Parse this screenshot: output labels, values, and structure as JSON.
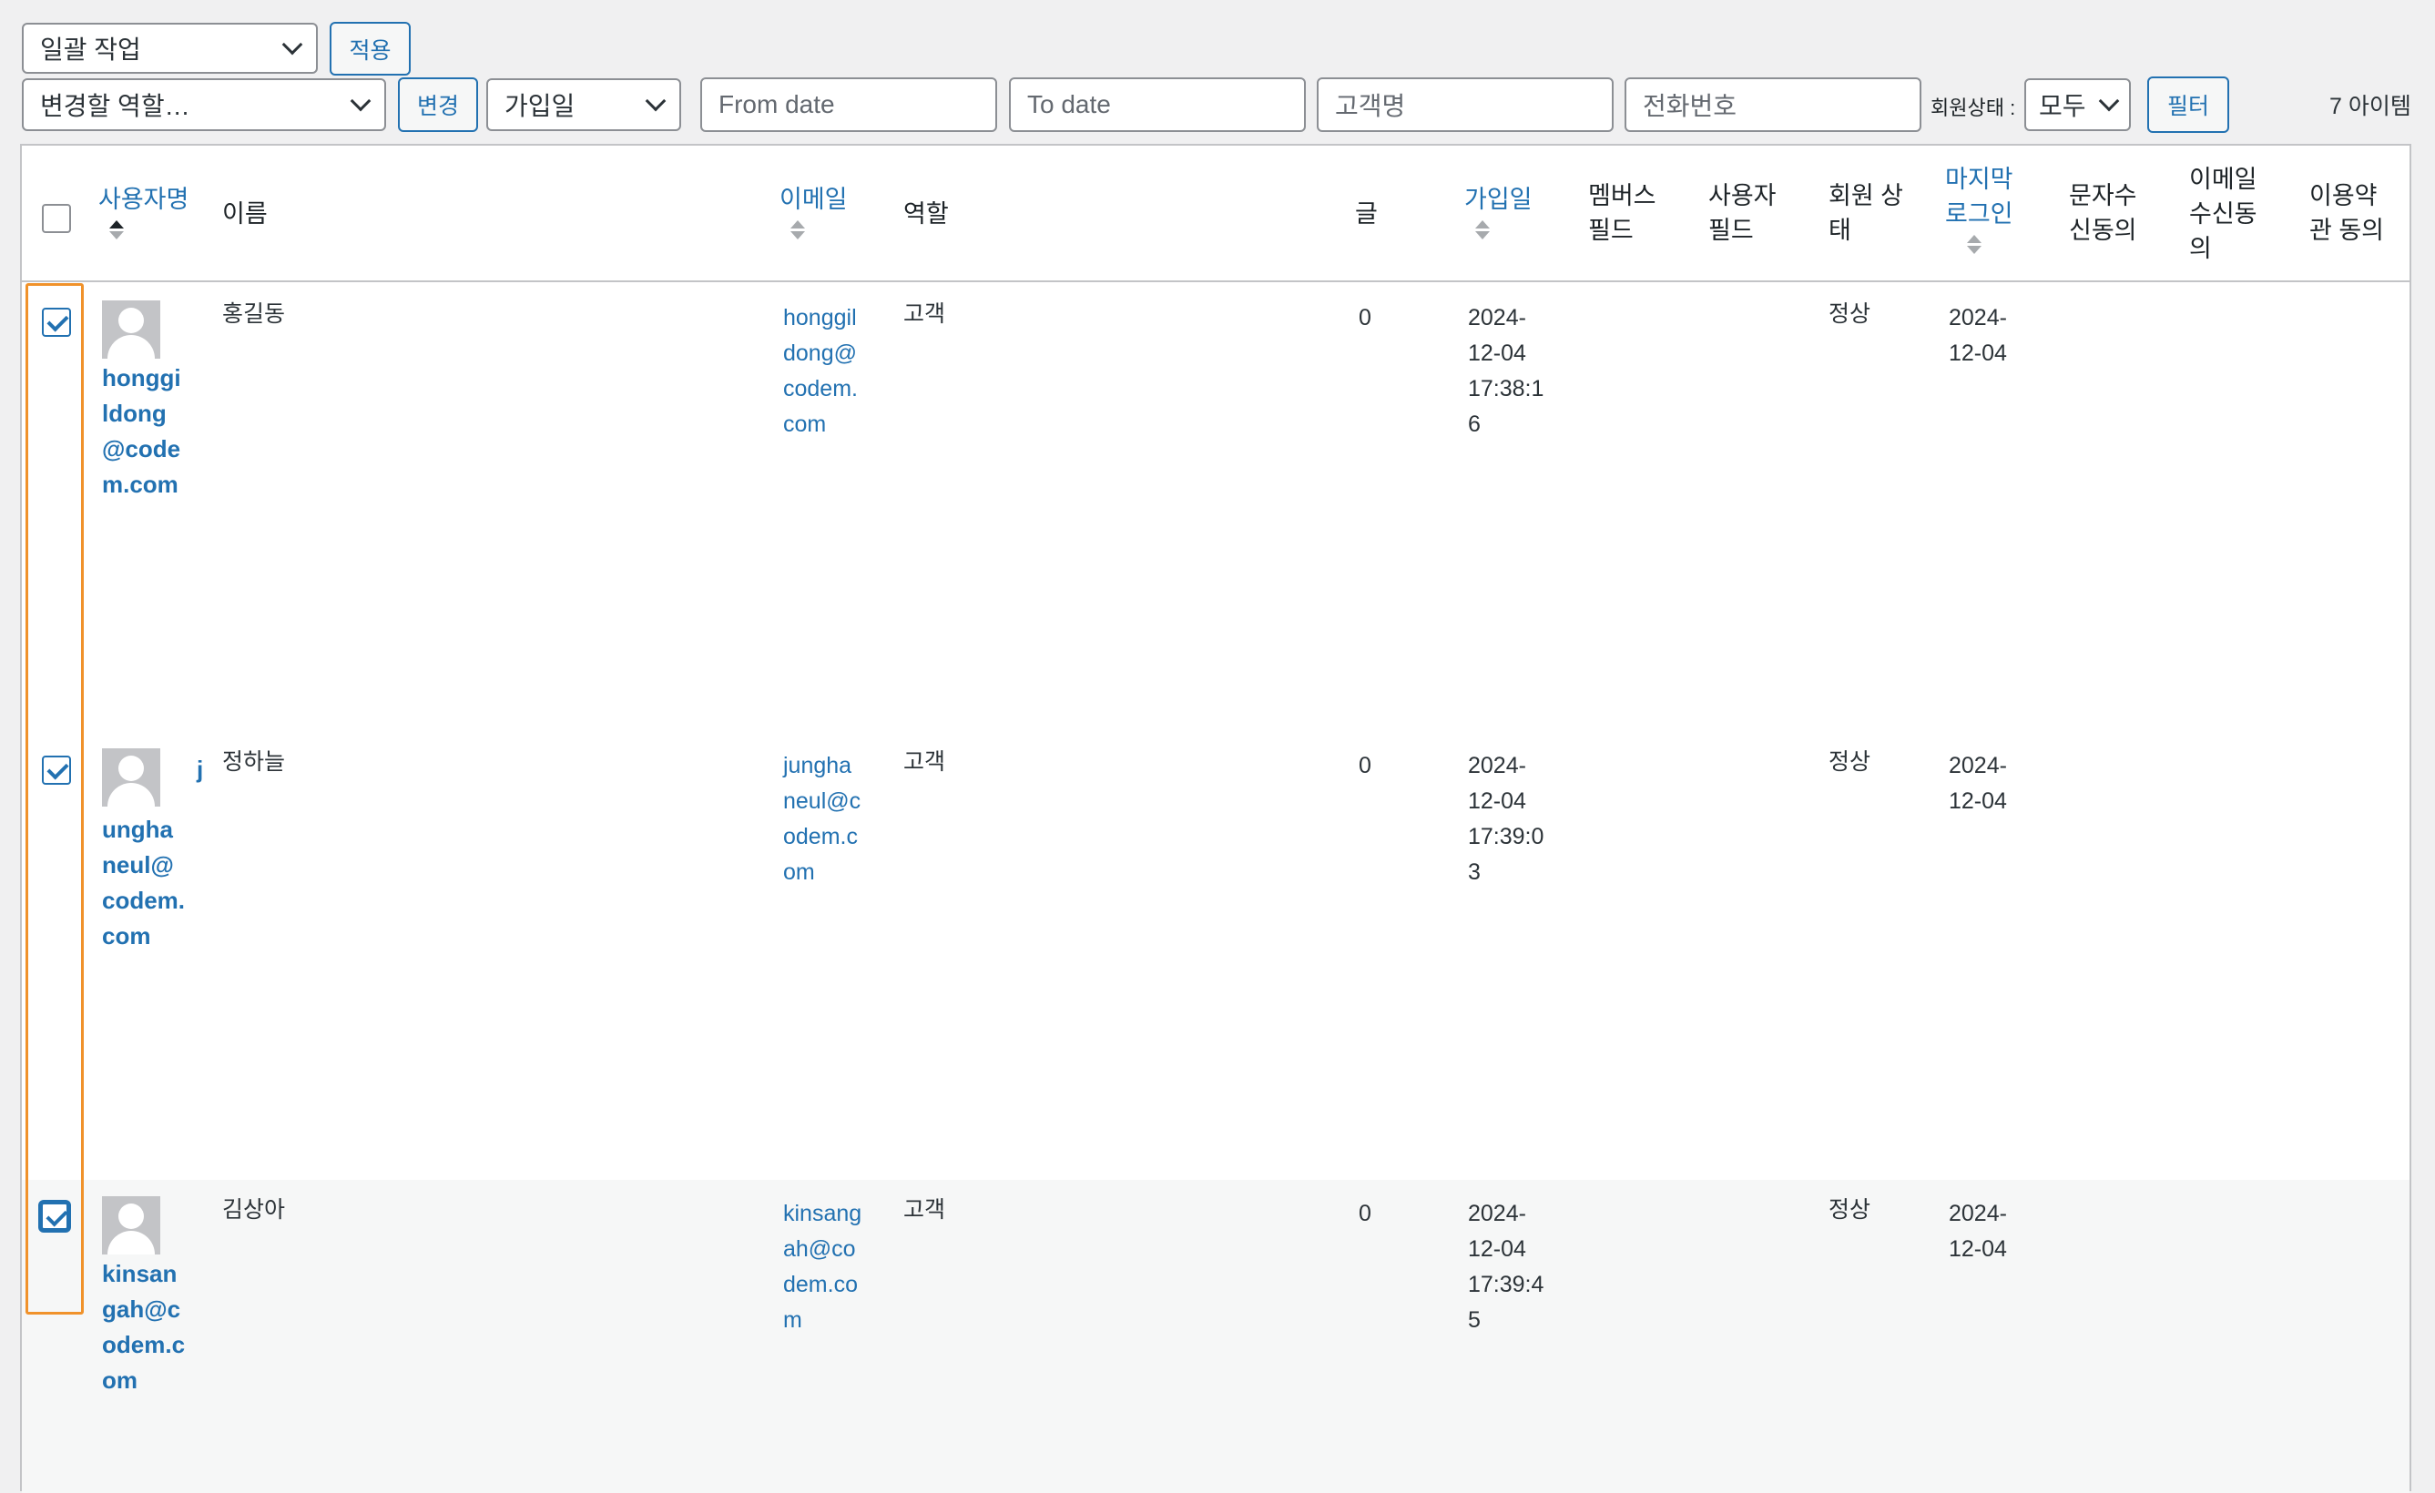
{
  "toolbar": {
    "bulk_action": "일괄 작업",
    "apply_label": "적용",
    "role_change": "변경할 역할…",
    "change_label": "변경",
    "date_type": "가입일",
    "from_date_placeholder": "From date",
    "to_date_placeholder": "To date",
    "customer_placeholder": "고객명",
    "phone_placeholder": "전화번호",
    "status_label": "회원상태 :",
    "status_value": "모두",
    "filter_label": "필터",
    "item_count": "7 아이템"
  },
  "columns": {
    "username": "사용자명",
    "name": "이름",
    "email": "이메일",
    "role": "역할",
    "posts": "글",
    "registered": "가입일",
    "member_field_1": "멤버스",
    "member_field_2": "필드",
    "user_field_1": "사용자",
    "user_field_2": "필드",
    "status_1": "회원 상",
    "status_2": "태",
    "last_login_1": "마지막",
    "last_login_2": "로그인",
    "sms_1": "문자수",
    "sms_2": "신동의",
    "email_consent_1": "이메일",
    "email_consent_2": "수신동",
    "email_consent_3": "의",
    "terms_1": "이용약",
    "terms_2": "관 동의"
  },
  "rows": [
    {
      "username_lines": [
        "honggi",
        "ldong",
        "@code",
        "m.com"
      ],
      "name": "홍길동",
      "email_lines": [
        "honggil",
        "dong@",
        "codem.",
        "com"
      ],
      "role": "고객",
      "posts": "0",
      "registered_lines": [
        "2024-",
        "12-04",
        "17:38:1",
        "6"
      ],
      "status": "정상",
      "last_login_lines": [
        "2024-",
        "12-04"
      ]
    },
    {
      "username_lines": [
        "j",
        "ungha",
        "neul@",
        "codem.",
        "com"
      ],
      "name": "정하늘",
      "email_lines": [
        "jungha",
        "neul@c",
        "odem.c",
        "om"
      ],
      "role": "고객",
      "posts": "0",
      "registered_lines": [
        "2024-",
        "12-04",
        "17:39:0",
        "3"
      ],
      "status": "정상",
      "last_login_lines": [
        "2024-",
        "12-04"
      ]
    },
    {
      "username_lines": [
        "kinsan",
        "gah@c",
        "odem.c",
        "om"
      ],
      "name": "김상아",
      "email_lines": [
        "kinsang",
        "ah@co",
        "dem.co",
        "m"
      ],
      "role": "고객",
      "posts": "0",
      "registered_lines": [
        "2024-",
        "12-04",
        "17:39:4",
        "5"
      ],
      "status": "정상",
      "last_login_lines": [
        "2024-",
        "12-04"
      ]
    }
  ]
}
